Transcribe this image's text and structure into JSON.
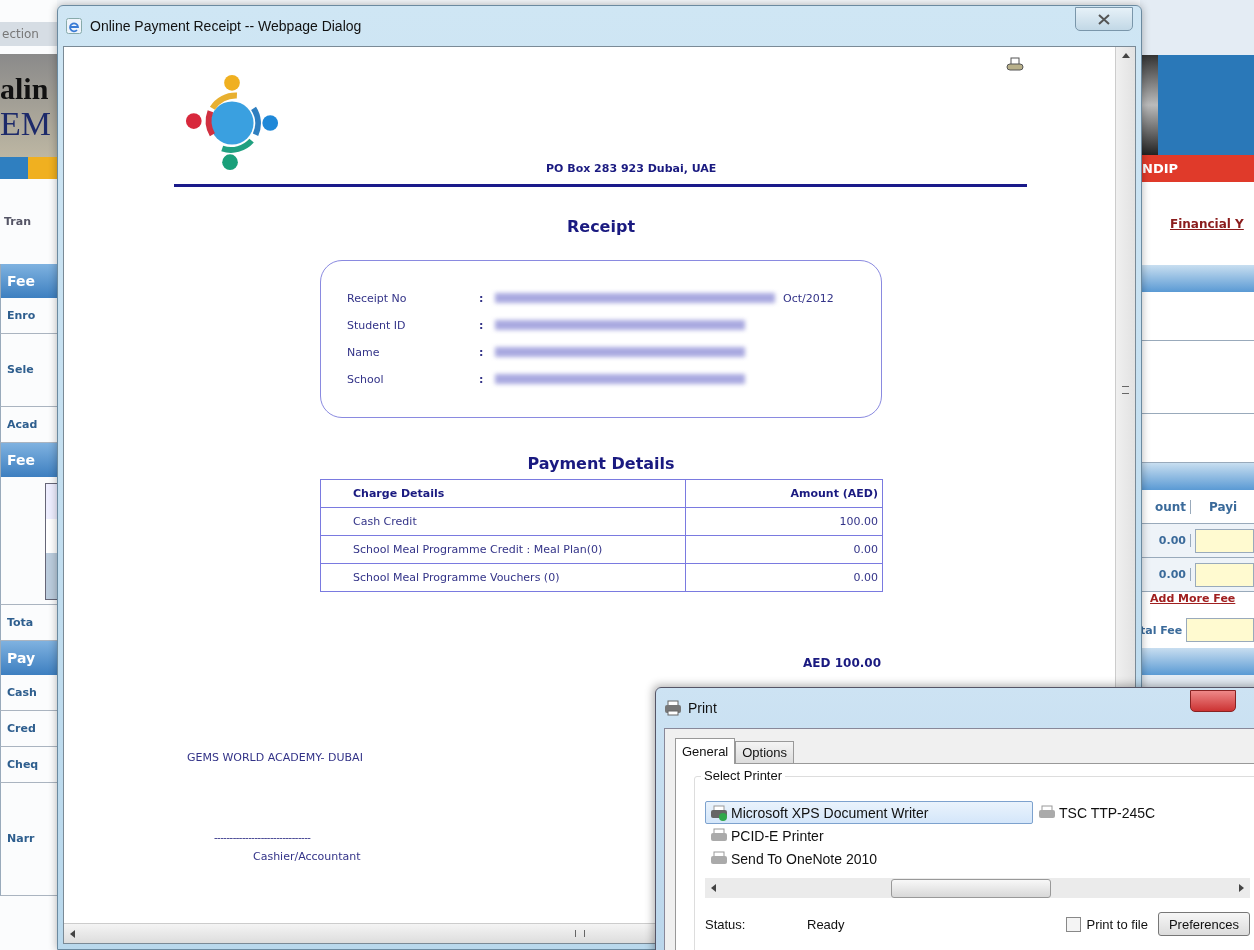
{
  "background_page": {
    "left": [
      {
        "kind": "tab",
        "text": "ection"
      },
      {
        "kind": "banner",
        "texts": [
          "alin",
          "EM"
        ]
      },
      {
        "kind": "link",
        "text": "Tran"
      },
      {
        "kind": "header",
        "text": "Fee"
      },
      {
        "kind": "row",
        "text": "Enro"
      },
      {
        "kind": "tall",
        "text": "Sele"
      },
      {
        "kind": "row",
        "text": "Acad"
      },
      {
        "kind": "header",
        "text": "Fee"
      },
      {
        "kind": "grid"
      },
      {
        "kind": "row",
        "text": "Tota"
      },
      {
        "kind": "header",
        "text": "Pay"
      },
      {
        "kind": "row",
        "text": "Cash"
      },
      {
        "kind": "row",
        "text": "Cred"
      },
      {
        "kind": "row",
        "text": "Cheq"
      },
      {
        "kind": "area",
        "text": "Narr"
      }
    ],
    "right": [
      {
        "kind": "banner"
      },
      {
        "kind": "redbar",
        "text": "NDIP"
      },
      {
        "kind": "link",
        "text": "Financial Y"
      },
      {
        "kind": "header"
      },
      {
        "kind": "row"
      },
      {
        "kind": "tall"
      },
      {
        "kind": "row"
      },
      {
        "kind": "header"
      },
      {
        "kind": "columns",
        "cells": [
          "ount",
          "Payi"
        ]
      },
      {
        "kind": "amount",
        "text": "0.00"
      },
      {
        "kind": "amount",
        "text": "0.00"
      },
      {
        "kind": "addlink",
        "text": "Add More Fee"
      },
      {
        "kind": "total",
        "text": "tal Fee"
      },
      {
        "kind": "header"
      }
    ]
  },
  "dialog": {
    "title": "Online Payment Receipt -- Webpage Dialog",
    "receipt": {
      "address": "PO Box 283 923 Dubai, UAE",
      "title": "Receipt",
      "fields": [
        {
          "label": "Receipt No",
          "separator": ":",
          "redacted": true,
          "suffix": "Oct/2012"
        },
        {
          "label": "Student ID",
          "separator": ":",
          "redacted": true
        },
        {
          "label": "Name",
          "separator": ":",
          "redacted": true
        },
        {
          "label": "School",
          "separator": ":",
          "redacted": true
        }
      ],
      "payment_title": "Payment Details",
      "table": {
        "columns": [
          "Charge Details",
          "Amount (AED)"
        ],
        "rows": [
          [
            "Cash Credit",
            "100.00"
          ],
          [
            "School Meal Programme Credit : Meal Plan(0)",
            "0.00"
          ],
          [
            "School Meal Programme Vouchers (0)",
            "0.00"
          ]
        ]
      },
      "total": "AED 100.00",
      "school": "GEMS WORLD ACADEMY- DUBAI",
      "signature_line": "-------------------------------",
      "signatory": "Cashier/Accountant"
    }
  },
  "print_dialog": {
    "title": "Print",
    "tabs": [
      {
        "label": "General",
        "selected": true
      },
      {
        "label": "Options",
        "selected": false
      }
    ],
    "group": "Select Printer",
    "printers": [
      {
        "name": "Microsoft XPS Document Writer",
        "selected": true,
        "default": true
      },
      {
        "name": "PCID-E Printer",
        "selected": false,
        "default": false
      },
      {
        "name": "Send To OneNote 2010",
        "selected": false,
        "default": false
      },
      {
        "name": "TSC TTP-245C",
        "selected": false,
        "default": false
      }
    ],
    "status_label": "Status:",
    "status_value": "Ready",
    "print_to_file": {
      "label": "Print to file",
      "checked": false
    },
    "preferences_button": "Preferences"
  }
}
